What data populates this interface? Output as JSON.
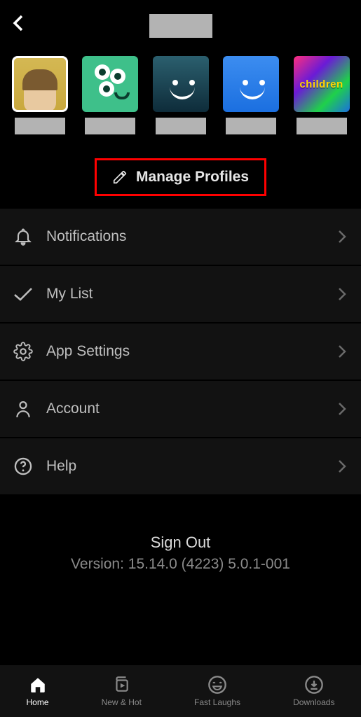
{
  "profiles": [
    {
      "children_label": ""
    },
    {
      "children_label": ""
    },
    {
      "children_label": ""
    },
    {
      "children_label": ""
    },
    {
      "children_label": "children"
    }
  ],
  "manage_button": {
    "label": "Manage Profiles"
  },
  "menu": {
    "notifications": "Notifications",
    "my_list": "My List",
    "app_settings": "App Settings",
    "account": "Account",
    "help": "Help"
  },
  "footer": {
    "sign_out": "Sign Out",
    "version": "Version: 15.14.0 (4223) 5.0.1-001"
  },
  "bottom_nav": {
    "home": "Home",
    "new_hot": "New & Hot",
    "fast_laughs": "Fast Laughs",
    "downloads": "Downloads"
  }
}
